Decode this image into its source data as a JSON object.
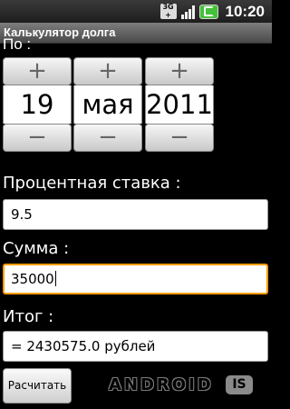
{
  "status_bar": {
    "network_icon": "3g-icon",
    "network_line1": "3G",
    "network_line2": "+",
    "signal_icon": "signal-bars-icon",
    "battery_icon": "battery-charging-icon",
    "battery_color": "#44c13a",
    "time": "10:20"
  },
  "app": {
    "title": "Калькулятор долга"
  },
  "scrolled_label": "По :",
  "date_picker": {
    "day": {
      "increment": "+",
      "value": "19",
      "decrement": "−"
    },
    "month": {
      "increment": "+",
      "value": "мая",
      "decrement": "−"
    },
    "year": {
      "increment": "+",
      "value": "2011",
      "decrement": "−"
    }
  },
  "rate": {
    "label": "Процентная ставка :",
    "value": "9.5"
  },
  "sum": {
    "label": "Сумма :",
    "value": "35000"
  },
  "result": {
    "label": "Итог :",
    "value": "= 2430575.0  рублей"
  },
  "calculate_button": {
    "label": "Расчитать"
  },
  "watermark": {
    "text": "ANDROID",
    "badge": "IS"
  },
  "colors": {
    "focus_border": "#ff9c00",
    "background": "#000000"
  }
}
